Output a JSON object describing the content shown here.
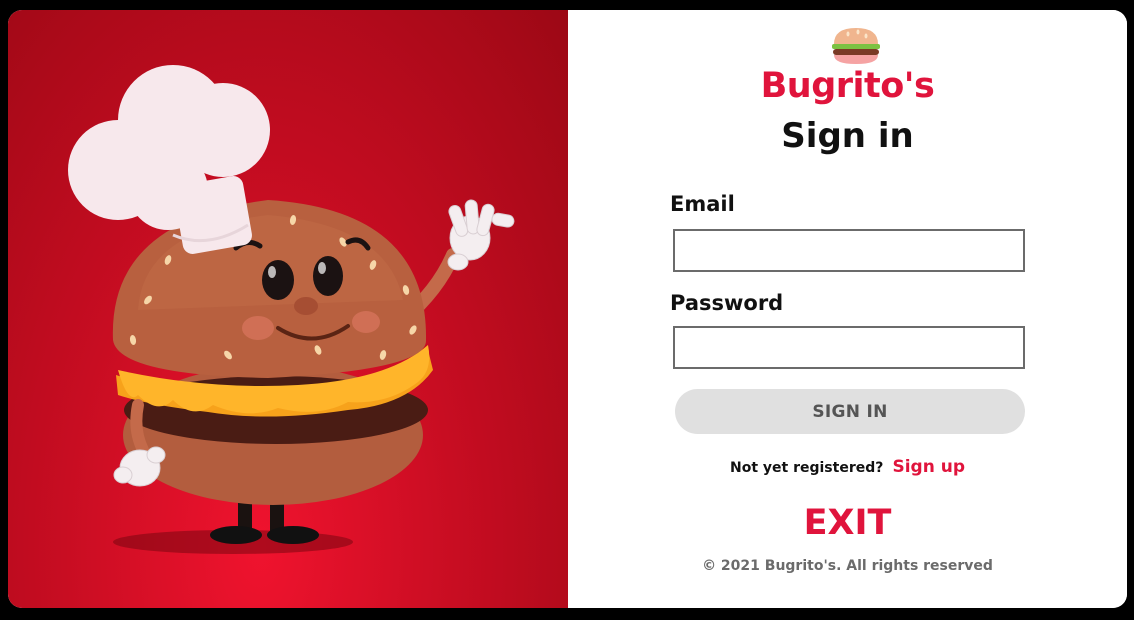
{
  "brand": {
    "name": "Bugrito's",
    "logo_icon": "burger-icon",
    "accent_color": "#e0143c"
  },
  "form": {
    "title": "Sign in",
    "email_label": "Email",
    "email_value": "",
    "password_label": "Password",
    "password_value": "",
    "submit_label": "SIGN IN"
  },
  "register": {
    "prompt": "Not yet registered?",
    "link_label": "Sign up"
  },
  "exit_label": "EXIT",
  "footer": {
    "copyright": "© 2021 Bugrito's. All rights reserved"
  },
  "hero": {
    "illustration": "burger-chef-mascot",
    "background_color": "#c80d22"
  }
}
